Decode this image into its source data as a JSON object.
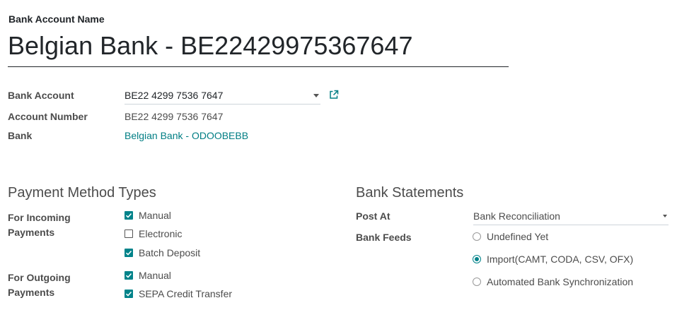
{
  "bank_account_name": {
    "label": "Bank Account Name",
    "value": "Belgian Bank - BE22429975367647"
  },
  "fields": {
    "bank_account": {
      "label": "Bank Account",
      "value": "BE22 4299 7536 7647"
    },
    "account_number": {
      "label": "Account Number",
      "value": "BE22 4299 7536 7647"
    },
    "bank": {
      "label": "Bank",
      "value": "Belgian Bank - ODOOBEBB"
    }
  },
  "payment_methods": {
    "title": "Payment Method Types",
    "incoming": {
      "label_line1": "For Incoming",
      "label_line2": "Payments",
      "options": [
        {
          "label": "Manual",
          "checked": true
        },
        {
          "label": "Electronic",
          "checked": false
        },
        {
          "label": "Batch Deposit",
          "checked": true
        }
      ]
    },
    "outgoing": {
      "label_line1": "For Outgoing",
      "label_line2": "Payments",
      "options": [
        {
          "label": "Manual",
          "checked": true
        },
        {
          "label": "SEPA Credit Transfer",
          "checked": true
        }
      ]
    }
  },
  "bank_statements": {
    "title": "Bank Statements",
    "post_at": {
      "label": "Post At",
      "value": "Bank Reconciliation"
    },
    "bank_feeds": {
      "label": "Bank Feeds",
      "options": [
        {
          "label": "Undefined Yet",
          "selected": false
        },
        {
          "label": "Import(CAMT, CODA, CSV, OFX)",
          "selected": true
        },
        {
          "label": "Automated Bank Synchronization",
          "selected": false
        }
      ]
    }
  },
  "colors": {
    "accent": "#01838a",
    "link": "#017e84",
    "text": "#4c4c4c"
  },
  "icons": {
    "external_link": "external-link-icon",
    "dropdown": "chevron-down-icon",
    "checkbox_checked": "checkmark-icon"
  }
}
